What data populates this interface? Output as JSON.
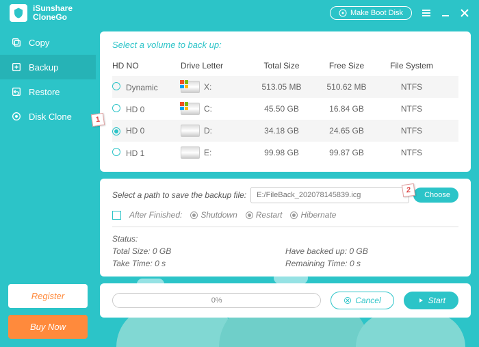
{
  "brand": {
    "line1": "iSunshare",
    "line2": "CloneGo"
  },
  "titlebar": {
    "make_boot": "Make Boot Disk"
  },
  "sidebar": {
    "items": [
      {
        "label": "Copy"
      },
      {
        "label": "Backup"
      },
      {
        "label": "Restore"
      },
      {
        "label": "Disk Clone"
      }
    ],
    "register": "Register",
    "buynow": "Buy Now"
  },
  "volumes": {
    "title": "Select a volume to back up:",
    "headers": {
      "hdno": "HD NO",
      "letter": "Drive Letter",
      "total": "Total Size",
      "free": "Free Size",
      "fs": "File System"
    },
    "rows": [
      {
        "name": "Dynamic",
        "letter": "X:",
        "total": "513.05 MB",
        "free": "510.62 MB",
        "fs": "NTFS",
        "win": true,
        "sel": false
      },
      {
        "name": "HD 0",
        "letter": "C:",
        "total": "45.50 GB",
        "free": "16.84 GB",
        "fs": "NTFS",
        "win": true,
        "sel": false
      },
      {
        "name": "HD 0",
        "letter": "D:",
        "total": "34.18 GB",
        "free": "24.65 GB",
        "fs": "NTFS",
        "win": false,
        "sel": true
      },
      {
        "name": "HD 1",
        "letter": "E:",
        "total": "99.98 GB",
        "free": "99.87 GB",
        "fs": "NTFS",
        "win": false,
        "sel": false
      }
    ]
  },
  "path": {
    "label": "Select a path to save the backup file:",
    "value": "E:/FileBack_202078145839.icg",
    "choose": "Choose"
  },
  "after": {
    "label": "After Finished:",
    "opts": {
      "shutdown": "Shutdown",
      "restart": "Restart",
      "hibernate": "Hibernate"
    }
  },
  "status": {
    "title": "Status:",
    "total_label": "Total Size: ",
    "total_val": "0 GB",
    "backed_label": "Have backed up: ",
    "backed_val": "0 GB",
    "take_label": "Take Time: ",
    "take_val": "0 s",
    "remain_label": "Remaining Time: ",
    "remain_val": "0 s"
  },
  "progress": {
    "pct": "0%",
    "cancel": "Cancel",
    "start": "Start"
  },
  "callouts": {
    "one": "1",
    "two": "2"
  }
}
